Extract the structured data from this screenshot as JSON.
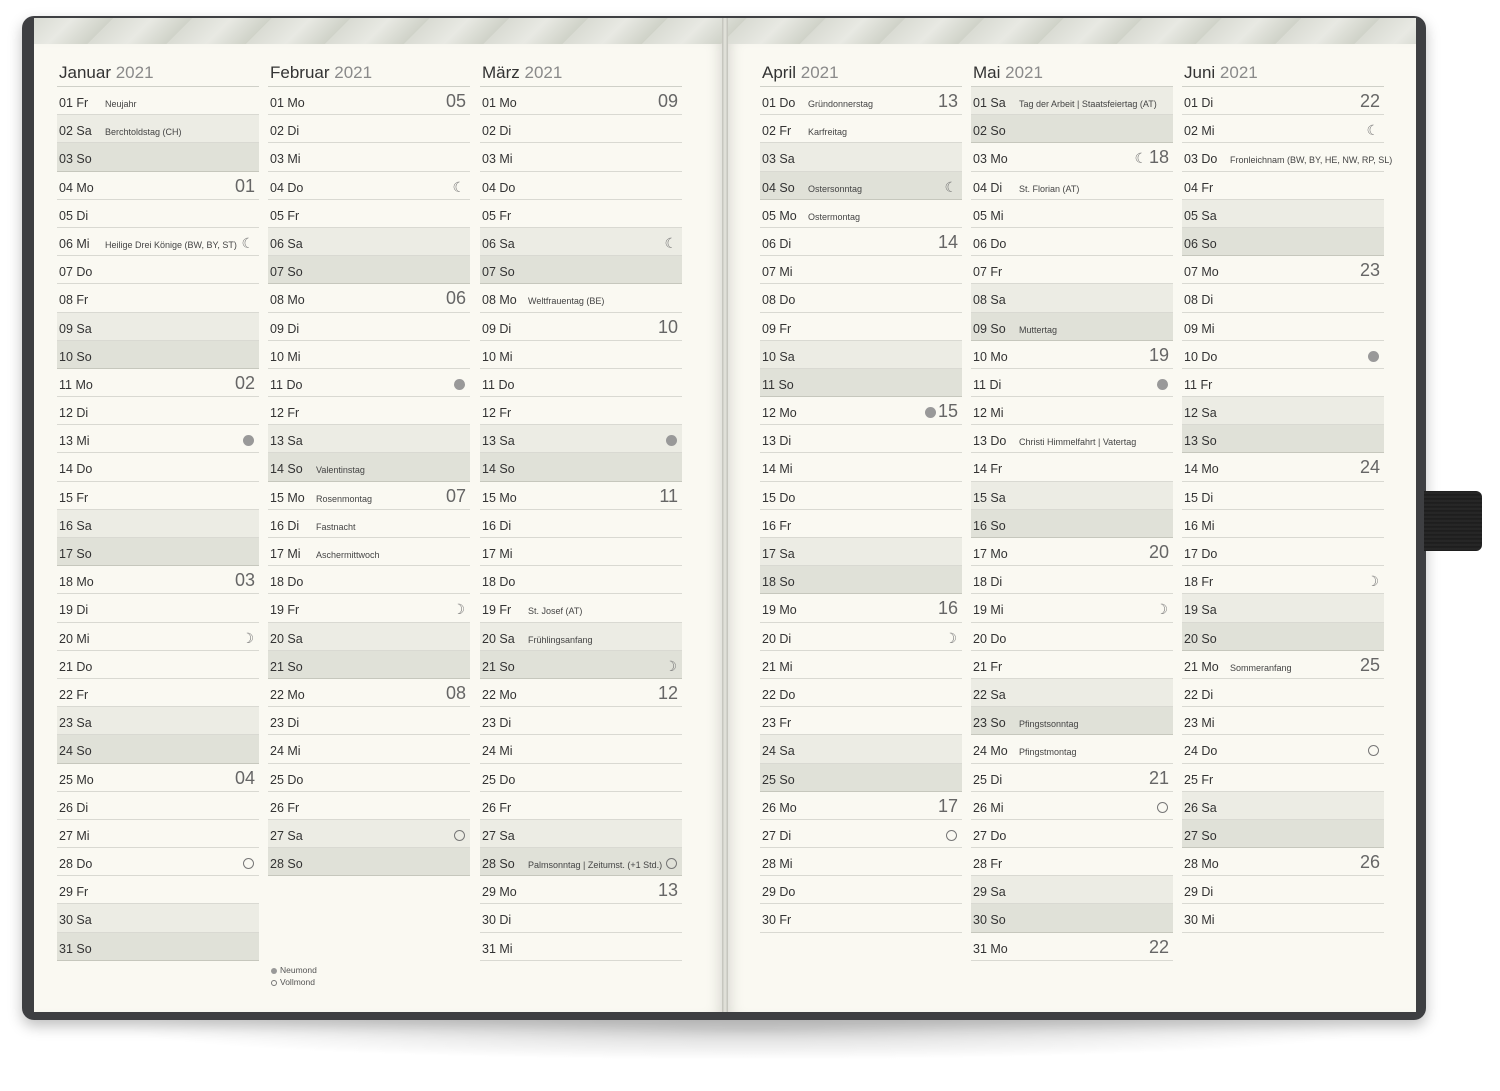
{
  "legend": {
    "new_moon": "Neumond",
    "full_moon": "Vollmond"
  },
  "months": [
    {
      "name": "Januar",
      "year": "2021",
      "days": [
        {
          "d": "01",
          "wd": "Fr",
          "hol": "Neujahr"
        },
        {
          "d": "02",
          "wd": "Sa",
          "hol": "Berchtoldstag (CH)"
        },
        {
          "d": "03",
          "wd": "So"
        },
        {
          "d": "04",
          "wd": "Mo",
          "cw": "01"
        },
        {
          "d": "05",
          "wd": "Di"
        },
        {
          "d": "06",
          "wd": "Mi",
          "hol": "Heilige Drei Könige (BW, BY, ST)",
          "moon": "half"
        },
        {
          "d": "07",
          "wd": "Do"
        },
        {
          "d": "08",
          "wd": "Fr"
        },
        {
          "d": "09",
          "wd": "Sa"
        },
        {
          "d": "10",
          "wd": "So"
        },
        {
          "d": "11",
          "wd": "Mo",
          "cw": "02"
        },
        {
          "d": "12",
          "wd": "Di"
        },
        {
          "d": "13",
          "wd": "Mi",
          "moon": "new"
        },
        {
          "d": "14",
          "wd": "Do"
        },
        {
          "d": "15",
          "wd": "Fr"
        },
        {
          "d": "16",
          "wd": "Sa"
        },
        {
          "d": "17",
          "wd": "So"
        },
        {
          "d": "18",
          "wd": "Mo",
          "cw": "03"
        },
        {
          "d": "19",
          "wd": "Di"
        },
        {
          "d": "20",
          "wd": "Mi",
          "moon": "waxing"
        },
        {
          "d": "21",
          "wd": "Do"
        },
        {
          "d": "22",
          "wd": "Fr"
        },
        {
          "d": "23",
          "wd": "Sa"
        },
        {
          "d": "24",
          "wd": "So"
        },
        {
          "d": "25",
          "wd": "Mo",
          "cw": "04"
        },
        {
          "d": "26",
          "wd": "Di"
        },
        {
          "d": "27",
          "wd": "Mi"
        },
        {
          "d": "28",
          "wd": "Do",
          "moon": "full"
        },
        {
          "d": "29",
          "wd": "Fr"
        },
        {
          "d": "30",
          "wd": "Sa"
        },
        {
          "d": "31",
          "wd": "So"
        }
      ]
    },
    {
      "name": "Februar",
      "year": "2021",
      "days": [
        {
          "d": "01",
          "wd": "Mo",
          "cw": "05"
        },
        {
          "d": "02",
          "wd": "Di"
        },
        {
          "d": "03",
          "wd": "Mi"
        },
        {
          "d": "04",
          "wd": "Do",
          "moon": "half"
        },
        {
          "d": "05",
          "wd": "Fr"
        },
        {
          "d": "06",
          "wd": "Sa"
        },
        {
          "d": "07",
          "wd": "So"
        },
        {
          "d": "08",
          "wd": "Mo",
          "cw": "06"
        },
        {
          "d": "09",
          "wd": "Di"
        },
        {
          "d": "10",
          "wd": "Mi"
        },
        {
          "d": "11",
          "wd": "Do",
          "moon": "new"
        },
        {
          "d": "12",
          "wd": "Fr"
        },
        {
          "d": "13",
          "wd": "Sa"
        },
        {
          "d": "14",
          "wd": "So",
          "hol": "Valentinstag"
        },
        {
          "d": "15",
          "wd": "Mo",
          "hol": "Rosenmontag",
          "cw": "07"
        },
        {
          "d": "16",
          "wd": "Di",
          "hol": "Fastnacht"
        },
        {
          "d": "17",
          "wd": "Mi",
          "hol": "Aschermittwoch"
        },
        {
          "d": "18",
          "wd": "Do"
        },
        {
          "d": "19",
          "wd": "Fr",
          "moon": "waxing"
        },
        {
          "d": "20",
          "wd": "Sa"
        },
        {
          "d": "21",
          "wd": "So"
        },
        {
          "d": "22",
          "wd": "Mo",
          "cw": "08"
        },
        {
          "d": "23",
          "wd": "Di"
        },
        {
          "d": "24",
          "wd": "Mi"
        },
        {
          "d": "25",
          "wd": "Do"
        },
        {
          "d": "26",
          "wd": "Fr"
        },
        {
          "d": "27",
          "wd": "Sa",
          "moon": "full"
        },
        {
          "d": "28",
          "wd": "So"
        }
      ]
    },
    {
      "name": "März",
      "year": "2021",
      "days": [
        {
          "d": "01",
          "wd": "Mo",
          "cw": "09"
        },
        {
          "d": "02",
          "wd": "Di"
        },
        {
          "d": "03",
          "wd": "Mi"
        },
        {
          "d": "04",
          "wd": "Do"
        },
        {
          "d": "05",
          "wd": "Fr"
        },
        {
          "d": "06",
          "wd": "Sa",
          "moon": "half"
        },
        {
          "d": "07",
          "wd": "So"
        },
        {
          "d": "08",
          "wd": "Mo",
          "hol": "Weltfrauentag (BE)"
        },
        {
          "d": "09",
          "wd": "Di",
          "cw": "10"
        },
        {
          "d": "10",
          "wd": "Mi"
        },
        {
          "d": "11",
          "wd": "Do"
        },
        {
          "d": "12",
          "wd": "Fr"
        },
        {
          "d": "13",
          "wd": "Sa",
          "moon": "new"
        },
        {
          "d": "14",
          "wd": "So"
        },
        {
          "d": "15",
          "wd": "Mo",
          "cw": "11"
        },
        {
          "d": "16",
          "wd": "Di"
        },
        {
          "d": "17",
          "wd": "Mi"
        },
        {
          "d": "18",
          "wd": "Do"
        },
        {
          "d": "19",
          "wd": "Fr",
          "hol": "St. Josef (AT)"
        },
        {
          "d": "20",
          "wd": "Sa",
          "hol": "Frühlingsanfang"
        },
        {
          "d": "21",
          "wd": "So",
          "moon": "waxing"
        },
        {
          "d": "22",
          "wd": "Mo",
          "cw": "12"
        },
        {
          "d": "23",
          "wd": "Di"
        },
        {
          "d": "24",
          "wd": "Mi"
        },
        {
          "d": "25",
          "wd": "Do"
        },
        {
          "d": "26",
          "wd": "Fr"
        },
        {
          "d": "27",
          "wd": "Sa"
        },
        {
          "d": "28",
          "wd": "So",
          "hol": "Palmsonntag | Zeitumst. (+1 Std.)",
          "moon": "full"
        },
        {
          "d": "29",
          "wd": "Mo",
          "cw": "13"
        },
        {
          "d": "30",
          "wd": "Di"
        },
        {
          "d": "31",
          "wd": "Mi"
        }
      ]
    },
    {
      "name": "April",
      "year": "2021",
      "days": [
        {
          "d": "01",
          "wd": "Do",
          "hol": "Gründonnerstag",
          "cw": "13"
        },
        {
          "d": "02",
          "wd": "Fr",
          "hol": "Karfreitag"
        },
        {
          "d": "03",
          "wd": "Sa"
        },
        {
          "d": "04",
          "wd": "So",
          "hol": "Ostersonntag",
          "moon": "half"
        },
        {
          "d": "05",
          "wd": "Mo",
          "hol": "Ostermontag"
        },
        {
          "d": "06",
          "wd": "Di",
          "cw": "14"
        },
        {
          "d": "07",
          "wd": "Mi"
        },
        {
          "d": "08",
          "wd": "Do"
        },
        {
          "d": "09",
          "wd": "Fr"
        },
        {
          "d": "10",
          "wd": "Sa"
        },
        {
          "d": "11",
          "wd": "So"
        },
        {
          "d": "12",
          "wd": "Mo",
          "moon": "new",
          "cw": "15"
        },
        {
          "d": "13",
          "wd": "Di"
        },
        {
          "d": "14",
          "wd": "Mi"
        },
        {
          "d": "15",
          "wd": "Do"
        },
        {
          "d": "16",
          "wd": "Fr"
        },
        {
          "d": "17",
          "wd": "Sa"
        },
        {
          "d": "18",
          "wd": "So"
        },
        {
          "d": "19",
          "wd": "Mo",
          "cw": "16"
        },
        {
          "d": "20",
          "wd": "Di",
          "moon": "waxing"
        },
        {
          "d": "21",
          "wd": "Mi"
        },
        {
          "d": "22",
          "wd": "Do"
        },
        {
          "d": "23",
          "wd": "Fr"
        },
        {
          "d": "24",
          "wd": "Sa"
        },
        {
          "d": "25",
          "wd": "So"
        },
        {
          "d": "26",
          "wd": "Mo",
          "cw": "17"
        },
        {
          "d": "27",
          "wd": "Di",
          "moon": "full"
        },
        {
          "d": "28",
          "wd": "Mi"
        },
        {
          "d": "29",
          "wd": "Do"
        },
        {
          "d": "30",
          "wd": "Fr"
        }
      ]
    },
    {
      "name": "Mai",
      "year": "2021",
      "days": [
        {
          "d": "01",
          "wd": "Sa",
          "hol": "Tag der Arbeit | Staatsfeiertag (AT)"
        },
        {
          "d": "02",
          "wd": "So"
        },
        {
          "d": "03",
          "wd": "Mo",
          "moon": "half",
          "cw": "18"
        },
        {
          "d": "04",
          "wd": "Di",
          "hol": "St. Florian (AT)"
        },
        {
          "d": "05",
          "wd": "Mi"
        },
        {
          "d": "06",
          "wd": "Do"
        },
        {
          "d": "07",
          "wd": "Fr"
        },
        {
          "d": "08",
          "wd": "Sa"
        },
        {
          "d": "09",
          "wd": "So",
          "hol": "Muttertag"
        },
        {
          "d": "10",
          "wd": "Mo",
          "cw": "19"
        },
        {
          "d": "11",
          "wd": "Di",
          "moon": "new"
        },
        {
          "d": "12",
          "wd": "Mi"
        },
        {
          "d": "13",
          "wd": "Do",
          "hol": "Christi Himmelfahrt | Vatertag"
        },
        {
          "d": "14",
          "wd": "Fr"
        },
        {
          "d": "15",
          "wd": "Sa"
        },
        {
          "d": "16",
          "wd": "So"
        },
        {
          "d": "17",
          "wd": "Mo",
          "cw": "20"
        },
        {
          "d": "18",
          "wd": "Di"
        },
        {
          "d": "19",
          "wd": "Mi",
          "moon": "waxing"
        },
        {
          "d": "20",
          "wd": "Do"
        },
        {
          "d": "21",
          "wd": "Fr"
        },
        {
          "d": "22",
          "wd": "Sa"
        },
        {
          "d": "23",
          "wd": "So",
          "hol": "Pfingstsonntag"
        },
        {
          "d": "24",
          "wd": "Mo",
          "hol": "Pfingstmontag"
        },
        {
          "d": "25",
          "wd": "Di",
          "cw": "21"
        },
        {
          "d": "26",
          "wd": "Mi",
          "moon": "full"
        },
        {
          "d": "27",
          "wd": "Do"
        },
        {
          "d": "28",
          "wd": "Fr"
        },
        {
          "d": "29",
          "wd": "Sa"
        },
        {
          "d": "30",
          "wd": "So"
        },
        {
          "d": "31",
          "wd": "Mo",
          "cw": "22"
        }
      ]
    },
    {
      "name": "Juni",
      "year": "2021",
      "days": [
        {
          "d": "01",
          "wd": "Di",
          "cw": "22"
        },
        {
          "d": "02",
          "wd": "Mi",
          "moon": "half"
        },
        {
          "d": "03",
          "wd": "Do",
          "hol": "Fronleichnam (BW, BY, HE, NW, RP, SL)"
        },
        {
          "d": "04",
          "wd": "Fr"
        },
        {
          "d": "05",
          "wd": "Sa"
        },
        {
          "d": "06",
          "wd": "So"
        },
        {
          "d": "07",
          "wd": "Mo",
          "cw": "23"
        },
        {
          "d": "08",
          "wd": "Di"
        },
        {
          "d": "09",
          "wd": "Mi"
        },
        {
          "d": "10",
          "wd": "Do",
          "moon": "new"
        },
        {
          "d": "11",
          "wd": "Fr"
        },
        {
          "d": "12",
          "wd": "Sa"
        },
        {
          "d": "13",
          "wd": "So"
        },
        {
          "d": "14",
          "wd": "Mo",
          "cw": "24"
        },
        {
          "d": "15",
          "wd": "Di"
        },
        {
          "d": "16",
          "wd": "Mi"
        },
        {
          "d": "17",
          "wd": "Do"
        },
        {
          "d": "18",
          "wd": "Fr",
          "moon": "waxing"
        },
        {
          "d": "19",
          "wd": "Sa"
        },
        {
          "d": "20",
          "wd": "So"
        },
        {
          "d": "21",
          "wd": "Mo",
          "hol": "Sommeranfang",
          "cw": "25"
        },
        {
          "d": "22",
          "wd": "Di"
        },
        {
          "d": "23",
          "wd": "Mi"
        },
        {
          "d": "24",
          "wd": "Do",
          "moon": "full"
        },
        {
          "d": "25",
          "wd": "Fr"
        },
        {
          "d": "26",
          "wd": "Sa"
        },
        {
          "d": "27",
          "wd": "So"
        },
        {
          "d": "28",
          "wd": "Mo",
          "cw": "26"
        },
        {
          "d": "29",
          "wd": "Di"
        },
        {
          "d": "30",
          "wd": "Mi"
        }
      ]
    }
  ]
}
